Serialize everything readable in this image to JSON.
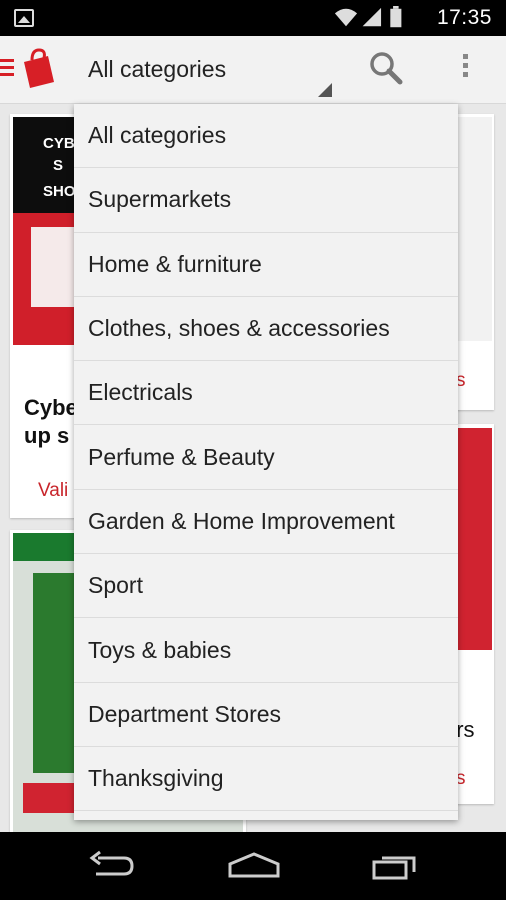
{
  "status_bar": {
    "time": "17:35"
  },
  "action_bar": {
    "category_selected": "All categories",
    "menu_icon": "hamburger-icon",
    "logo_icon": "shopping-bag-icon",
    "search_icon": "search-icon",
    "overflow_icon": "more-vert-icon"
  },
  "dropdown": {
    "items": [
      "All categories",
      "Supermarkets",
      "Home & furniture",
      "Clothes, shoes & accessories",
      "Electricals",
      "Perfume & Beauty",
      "Garden & Home Improvement",
      "Sport",
      "Toys & babies",
      "Department Stores",
      "Thanksgiving"
    ]
  },
  "cards": {
    "left_top": {
      "title_line1": "Cybe",
      "title_line2": "up s",
      "valid": "Vali"
    },
    "right_top": {
      "valid_tail": "s"
    },
    "right_bottom": {
      "title_tail": "ers",
      "valid_tail": "s"
    }
  },
  "colors": {
    "accent": "#d71f26",
    "status_bar": "#000000",
    "nav_bar": "#000000"
  }
}
